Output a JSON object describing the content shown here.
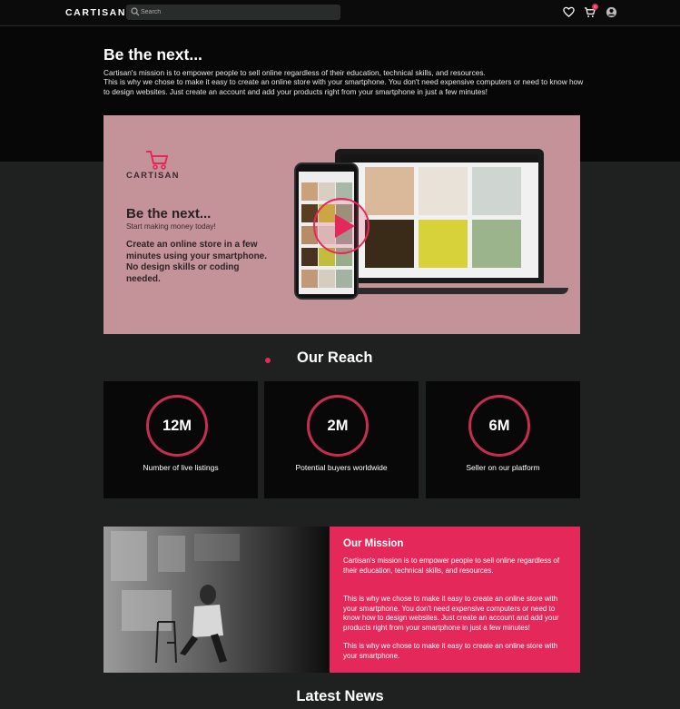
{
  "nav": {
    "logo": "CARTISAN",
    "search_placeholder": "Search",
    "cart_count": "0"
  },
  "intro": {
    "title": "Be the next...",
    "p1": "Cartisan's mission is to empower people to sell online regardless of their education, technical skills, and resources.",
    "p2": "This is why we chose to make it easy to create an online store with your smartphone. You don't need expensive computers or need to know how to design websites. Just create an account and add your products right from your smartphone in just a few minutes!"
  },
  "banner": {
    "logo": "CARTISAN",
    "title": "Be the next...",
    "subtitle": "Start making money today!",
    "body": "Create an online store in a few minutes using your smartphone. No design skills or coding needed."
  },
  "reach": {
    "title": "Our Reach",
    "cards": [
      {
        "value": "12M",
        "label": "Number of live listings"
      },
      {
        "value": "2M",
        "label": "Potential buyers worldwide"
      },
      {
        "value": "6M",
        "label": "Seller on our platform"
      }
    ]
  },
  "mission": {
    "title": "Our Mission",
    "p1": "Cartisan's mission is to empower people to sell online regardless of their education, technical skills, and resources.",
    "p2": "This is why we chose to make it easy to create an online store with your smartphone. You don't need expensive computers or need to know how to design websites. Just create an account and add your products right from your smartphone in just a few minutes!",
    "p3": "This is why we chose to make it easy to create an online store with your smartphone."
  },
  "news": {
    "title": "Latest News"
  },
  "colors": {
    "accent": "#e5285a",
    "banner_bg": "#c4939a",
    "page_bg": "#1f2020"
  },
  "icons": [
    "search-icon",
    "heart-icon",
    "cart-icon",
    "user-icon",
    "play-icon"
  ]
}
